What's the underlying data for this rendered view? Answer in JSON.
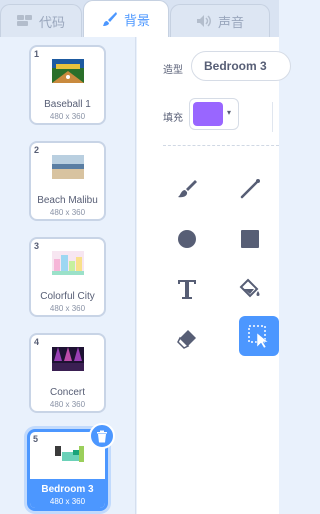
{
  "tabs": {
    "code": "代码",
    "backdrops": "背景",
    "sounds": "声音"
  },
  "backdrops": [
    {
      "number": "1",
      "name": "Baseball 1",
      "size": "480 x 360"
    },
    {
      "number": "2",
      "name": "Beach Malibu",
      "size": "480 x 360"
    },
    {
      "number": "3",
      "name": "Colorful City",
      "size": "480 x 360"
    },
    {
      "number": "4",
      "name": "Concert",
      "size": "480 x 360"
    },
    {
      "number": "5",
      "name": "Bedroom 3",
      "size": "480 x 360",
      "selected": true
    }
  ],
  "editor": {
    "costume_label": "造型",
    "costume_name": "Bedroom 3",
    "fill_label": "填充",
    "fill_color": "#9966ff"
  },
  "tools": [
    "brush-tool",
    "line-tool",
    "circle-tool",
    "rectangle-tool",
    "text-tool",
    "fill-tool",
    "eraser-tool",
    "select-tool"
  ],
  "colors": {
    "accent": "#4c97ff",
    "text": "#575e75"
  }
}
